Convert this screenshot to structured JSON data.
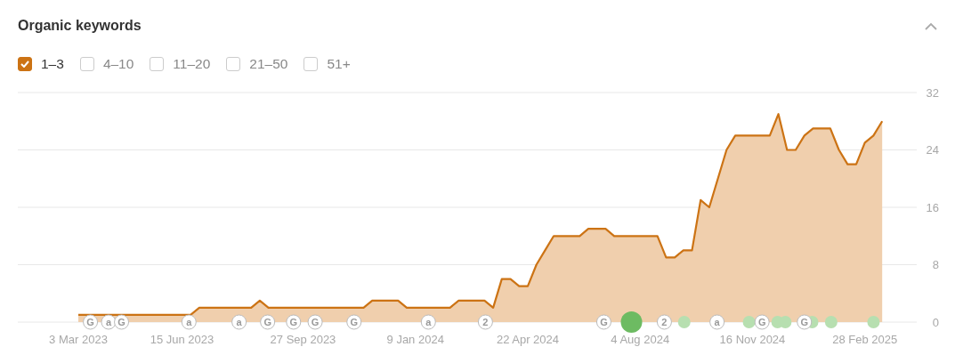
{
  "title": "Organic keywords",
  "filters": [
    {
      "label": "1–3",
      "checked": true
    },
    {
      "label": "4–10",
      "checked": false
    },
    {
      "label": "11–20",
      "checked": false
    },
    {
      "label": "21–50",
      "checked": false
    },
    {
      "label": "51+",
      "checked": false
    }
  ],
  "chart": {
    "chart_data": {
      "type": "area",
      "grid": true,
      "ylim": [
        0,
        32
      ],
      "categories": [
        null,
        null,
        null,
        null,
        null,
        null,
        null,
        "3 Mar 2023",
        null,
        null,
        null,
        null,
        null,
        null,
        null,
        null,
        null,
        null,
        null,
        "15 Jun 2023",
        null,
        null,
        null,
        null,
        null,
        null,
        null,
        null,
        null,
        null,
        null,
        null,
        null,
        "27 Sep 2023",
        null,
        null,
        null,
        null,
        null,
        null,
        null,
        null,
        null,
        null,
        null,
        null,
        "9 Jan 2024",
        null,
        null,
        null,
        null,
        null,
        null,
        null,
        null,
        null,
        null,
        null,
        null,
        "22 Apr 2024",
        null,
        null,
        null,
        null,
        null,
        null,
        null,
        null,
        null,
        null,
        null,
        null,
        "4 Aug 2024",
        null,
        null,
        null,
        null,
        null,
        null,
        null,
        null,
        null,
        null,
        null,
        null,
        "16 Nov 2024",
        null,
        null,
        null,
        null,
        null,
        null,
        null,
        null,
        null,
        null,
        null,
        null,
        "28 Feb 2025",
        null,
        null,
        null,
        null,
        null,
        null
      ],
      "series": [
        {
          "color": "#cc7314",
          "values": [
            null,
            null,
            null,
            null,
            null,
            null,
            null,
            1,
            1,
            1,
            1,
            1,
            1,
            1,
            1,
            1,
            1,
            1,
            1,
            1,
            1,
            2,
            2,
            2,
            2,
            2,
            2,
            2,
            3,
            2,
            2,
            2,
            2,
            2,
            2,
            2,
            2,
            2,
            2,
            2,
            2,
            3,
            3,
            3,
            3,
            2,
            2,
            2,
            2,
            2,
            2,
            3,
            3,
            3,
            3,
            2,
            6,
            6,
            5,
            5,
            8,
            10,
            12,
            12,
            12,
            12,
            13,
            13,
            13,
            12,
            12,
            12,
            12,
            12,
            12,
            9,
            9,
            10,
            10,
            17,
            16,
            20,
            24,
            26,
            26,
            26,
            26,
            26,
            29,
            24,
            24,
            26,
            27,
            27,
            27,
            24,
            22,
            22,
            25,
            26,
            28,
            null,
            null,
            null,
            null
          ]
        }
      ],
      "yticks": [
        0,
        8,
        16,
        24,
        32
      ]
    },
    "markers": [
      {
        "kind": "update",
        "label": "G"
      },
      {
        "kind": "update",
        "label": "a"
      },
      {
        "kind": "update",
        "label": "G"
      },
      {
        "kind": "update",
        "label": "a"
      },
      {
        "kind": "update",
        "label": "a"
      },
      {
        "kind": "update",
        "label": "G"
      },
      {
        "kind": "update",
        "label": "G"
      },
      {
        "kind": "update",
        "label": "G"
      },
      {
        "kind": "update",
        "label": "G"
      },
      {
        "kind": "update",
        "label": "a"
      },
      {
        "kind": "update",
        "label": "2"
      },
      {
        "kind": "update",
        "label": "G"
      },
      {
        "kind": "event_large"
      },
      {
        "kind": "update",
        "label": "2"
      },
      {
        "kind": "event"
      },
      {
        "kind": "update",
        "label": "a"
      },
      {
        "kind": "event"
      },
      {
        "kind": "update",
        "label": "G"
      },
      {
        "kind": "event"
      },
      {
        "kind": "event"
      },
      {
        "kind": "update",
        "label": "G"
      },
      {
        "kind": "event"
      },
      {
        "kind": "event"
      },
      {
        "kind": "event"
      }
    ]
  }
}
